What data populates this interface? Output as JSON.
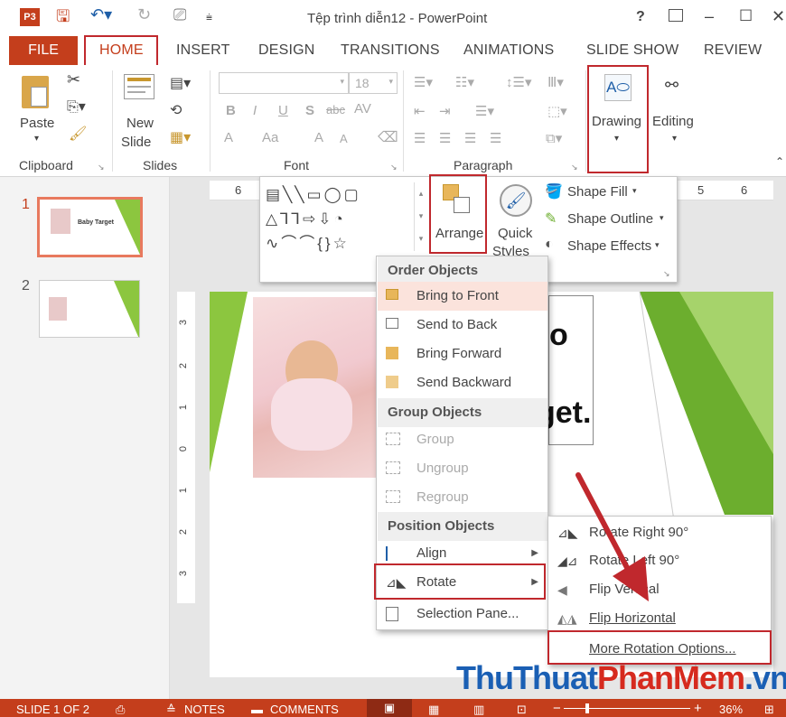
{
  "app": {
    "title": "Tệp trình diễn12 - PowerPoint",
    "help": "?",
    "minimize": "–",
    "maximize": "☐",
    "close": "✕"
  },
  "tabs": [
    {
      "label": "FILE"
    },
    {
      "label": "HOME"
    },
    {
      "label": "INSERT"
    },
    {
      "label": "DESIGN"
    },
    {
      "label": "TRANSITIONS"
    },
    {
      "label": "ANIMATIONS"
    },
    {
      "label": "SLIDE SHOW"
    },
    {
      "label": "REVIEW"
    }
  ],
  "ribbon": {
    "clipboard": {
      "paste": "Paste",
      "label": "Clipboard"
    },
    "slides": {
      "new_slide_1": "New",
      "new_slide_2": "Slide",
      "label": "Slides"
    },
    "font": {
      "size": "18",
      "bold": "B",
      "italic": "I",
      "underline": "U",
      "shadow": "S",
      "strike": "abc",
      "spacing": "AV",
      "color_a": "A",
      "case": "Aa",
      "grow": "A",
      "shrink": "A",
      "label": "Font"
    },
    "paragraph": {
      "label": "Paragraph"
    },
    "drawing": {
      "label": "Drawing"
    },
    "editing": {
      "label": "Editing"
    }
  },
  "drawing_pane": {
    "arrange": "Arrange",
    "quick_styles_1": "Quick",
    "quick_styles_2": "Styles",
    "shape_fill": "Shape Fill",
    "shape_outline": "Shape Outline",
    "shape_effects": "Shape Effects"
  },
  "ruler": {
    "left_num": "6",
    "r1": "5",
    "r2": "6"
  },
  "vruler": [
    "3",
    "2",
    "1",
    "0",
    "1",
    "2",
    "3"
  ],
  "thumbnails": [
    {
      "num": "1",
      "caption": "Baby Target"
    },
    {
      "num": "2"
    }
  ],
  "slide": {
    "text_1": "o",
    "text_2": "get."
  },
  "arrange_menu": {
    "order_header": "Order Objects",
    "bring_to_front": "Bring to Front",
    "send_to_back": "Send to Back",
    "bring_forward": "Bring Forward",
    "send_backward": "Send Backward",
    "group_header": "Group Objects",
    "group": "Group",
    "ungroup": "Ungroup",
    "regroup": "Regroup",
    "position_header": "Position Objects",
    "align": "Align",
    "rotate": "Rotate",
    "selection_pane": "Selection Pane..."
  },
  "rotate_menu": {
    "rotate_right": "Rotate Right 90°",
    "rotate_left": "Rotate Left 90°",
    "flip_vertical": "Flip Vertical",
    "flip_horizontal": "Flip Horizontal",
    "more_options": "More Rotation Options..."
  },
  "status": {
    "slide_count": "SLIDE 1 OF 2",
    "notes": "NOTES",
    "comments": "COMMENTS",
    "zoom": "36%",
    "zoom_minus": "−",
    "zoom_plus": "+"
  },
  "watermark": {
    "part1": "ThuThuat",
    "part2": "PhanMem",
    "part3": ".vn"
  },
  "colors": {
    "accent": "#c43e1c",
    "highlight_box": "#c0282d",
    "watermark_blue": "#1a5fb4",
    "watermark_red": "#d62a1e",
    "slide_green": "#7cb832"
  }
}
